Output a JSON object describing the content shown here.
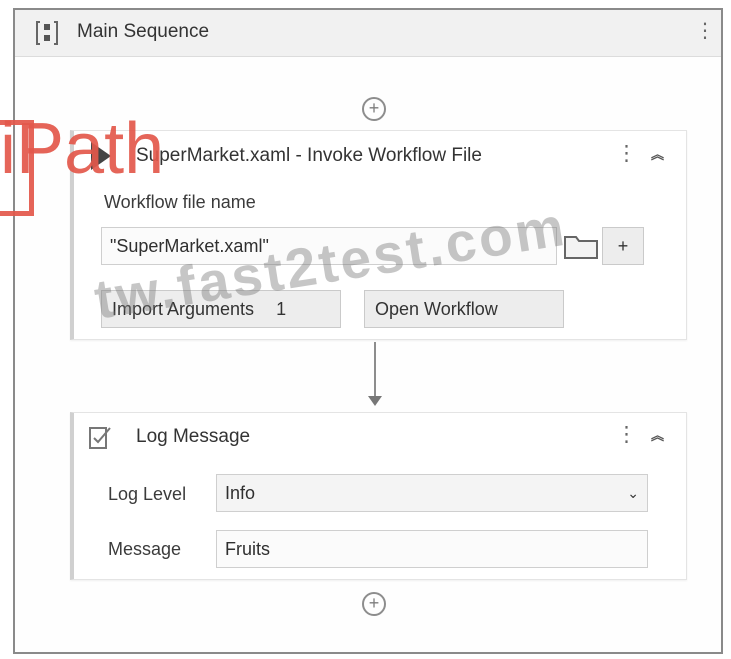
{
  "sequence": {
    "title": "Main Sequence",
    "icon": "sequence-icon",
    "more_icon": "⋮"
  },
  "add_glyph": "+",
  "invoke": {
    "title": "SuperMarket.xaml - Invoke Workflow File",
    "icon": "play-icon",
    "kebab": "⋮",
    "collapse": "︽",
    "file_label": "Workflow file name",
    "file_value": "\"SuperMarket.xaml\"",
    "browse_icon": "folder-icon",
    "plus_label": "+",
    "import_label": "Import Arguments",
    "import_count": "1",
    "open_label": "Open Workflow"
  },
  "log": {
    "title": "Log Message",
    "icon": "log-message-icon",
    "kebab": "⋮",
    "collapse": "︽",
    "level_label": "Log Level",
    "level_value": "Info",
    "message_label": "Message",
    "message_value": "Fruits"
  },
  "overlay": {
    "brand_text": "iPath",
    "watermark_text": "tw.fast2test.com"
  },
  "colors": {
    "brand": "#e3584b",
    "border": "#8a8a8a",
    "header_bg": "#f1f1f1"
  }
}
